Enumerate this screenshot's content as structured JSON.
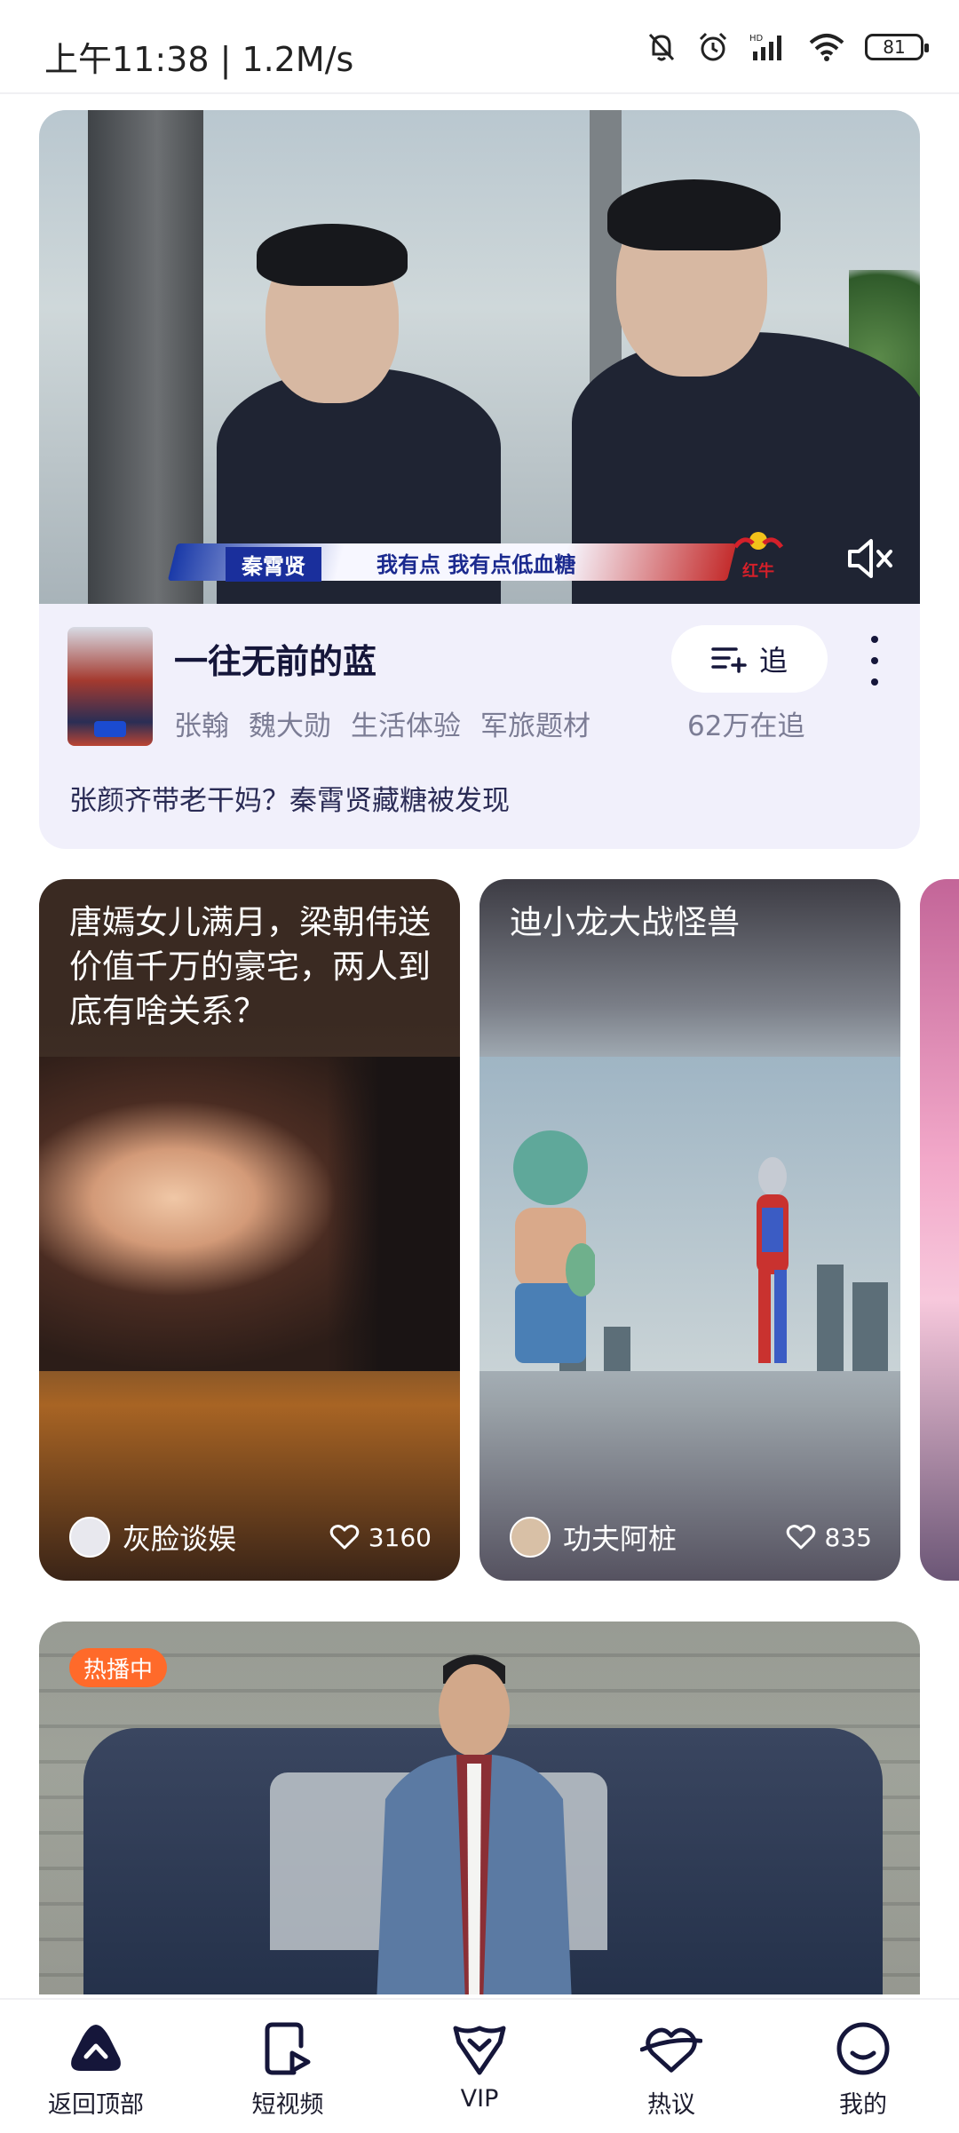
{
  "status_bar": {
    "time": "上午11:38 | 1.2M/s",
    "battery": "81"
  },
  "featured": {
    "subtitle_name": "秦霄贤",
    "subtitle_text": "我有点 我有点低血糖",
    "sponsor": "红牛",
    "title": "一往无前的蓝",
    "tags": [
      "张翰",
      "魏大勋",
      "生活体验",
      "军旅题材"
    ],
    "follow_label": "追",
    "follow_count": "62万在追",
    "description": "张颜齐带老干妈？秦霄贤藏糖被发现"
  },
  "short_videos": [
    {
      "title": "唐嫣女儿满月，梁朝伟送价值千万的豪宅，两人到底有啥关系？",
      "author": "灰脸谈娱",
      "likes": "3160"
    },
    {
      "title": "迪小龙大战怪兽",
      "author": "功夫阿桩",
      "likes": "835"
    }
  ],
  "hot": {
    "badge": "热播中"
  },
  "bottom_nav": [
    {
      "label": "返回顶部",
      "icon": "back-to-top-icon"
    },
    {
      "label": "短视频",
      "icon": "short-video-icon"
    },
    {
      "label": "VIP",
      "icon": "vip-icon"
    },
    {
      "label": "热议",
      "icon": "hot-discussion-icon"
    },
    {
      "label": "我的",
      "icon": "profile-icon"
    }
  ]
}
